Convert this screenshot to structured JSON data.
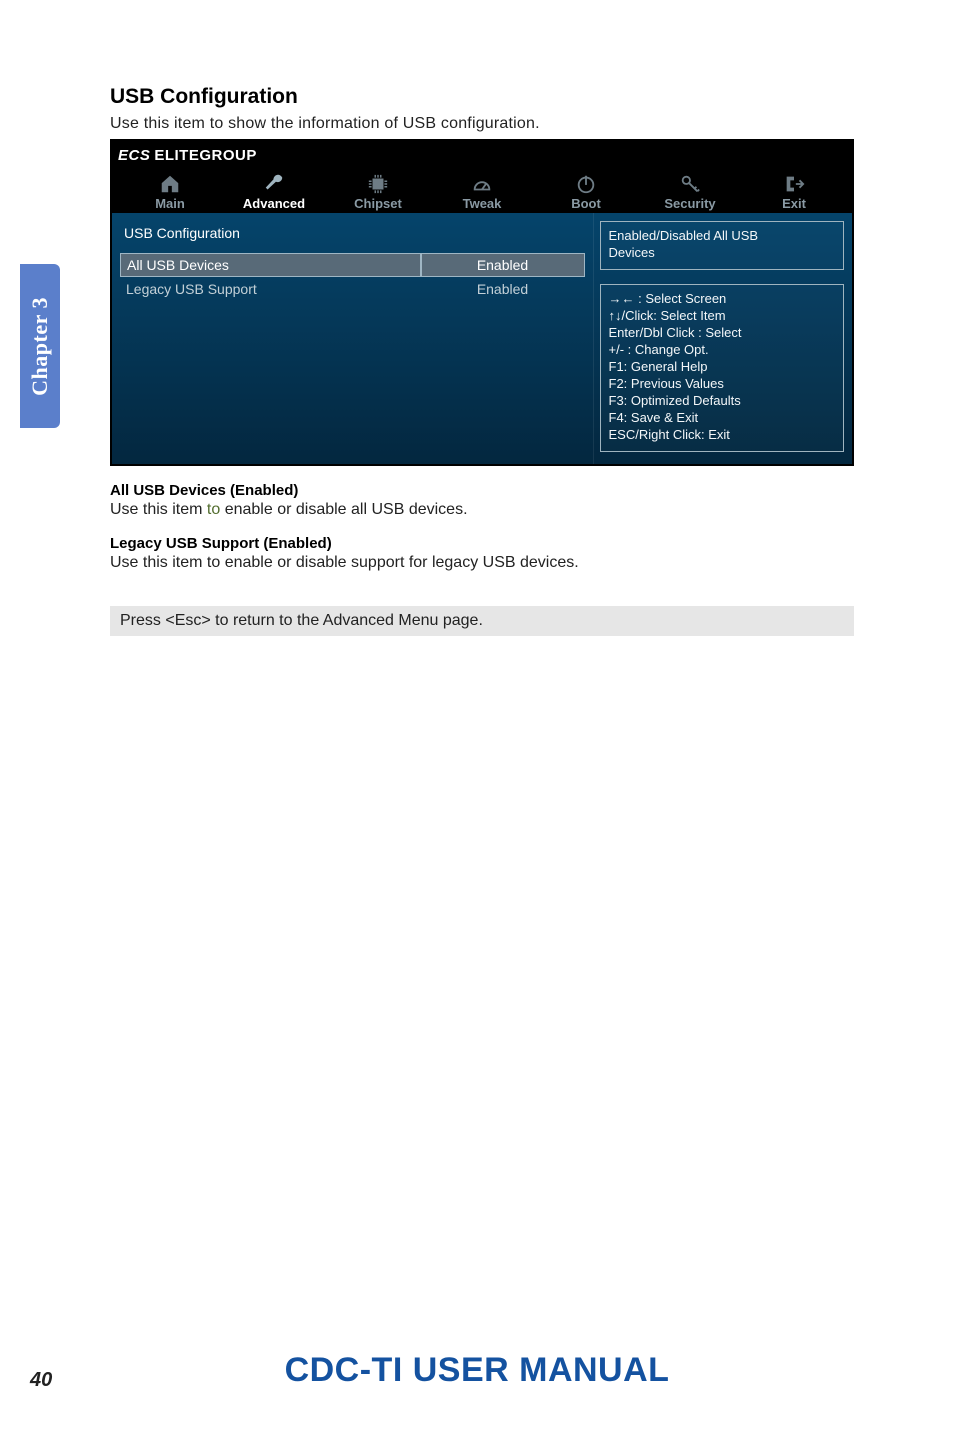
{
  "section": {
    "title": "USB Configuration",
    "desc": "Use this item to show the information of USB configuration."
  },
  "chapter_tab": "Chapter 3",
  "bios": {
    "brand_prefix": "ECS",
    "brand_name": "ELITEGROUP",
    "tabs": [
      {
        "name": "main",
        "label": "Main",
        "icon": "home-icon",
        "active": false
      },
      {
        "name": "advanced",
        "label": "Advanced",
        "icon": "wrench-icon",
        "active": true
      },
      {
        "name": "chipset",
        "label": "Chipset",
        "icon": "chip-icon",
        "active": false
      },
      {
        "name": "tweak",
        "label": "Tweak",
        "icon": "gauge-icon",
        "active": false
      },
      {
        "name": "boot",
        "label": "Boot",
        "icon": "power-icon",
        "active": false
      },
      {
        "name": "security",
        "label": "Security",
        "icon": "key-icon",
        "active": false
      },
      {
        "name": "exit",
        "label": "Exit",
        "icon": "exit-icon",
        "active": false
      }
    ],
    "heading": "USB Configuration",
    "rows": [
      {
        "label": "All USB Devices",
        "value": "Enabled",
        "selected": true
      },
      {
        "label": "Legacy USB Support",
        "value": "Enabled",
        "selected": false
      }
    ],
    "info_box": {
      "line1": "Enabled/Disabled All USB",
      "line2": "Devices"
    },
    "nav_box": {
      "l1": "→←   : Select Screen",
      "l2": "↑↓/Click: Select Item",
      "l3": "Enter/Dbl Click : Select",
      "l4": "+/- : Change Opt.",
      "l5": "F1: General Help",
      "l6": "F2: Previous Values",
      "l7": "F3: Optimized Defaults",
      "l8": "F4: Save & Exit",
      "l9": "ESC/Right Click: Exit"
    }
  },
  "items": [
    {
      "heading": "All USB Devices (Enabled)",
      "desc_pre": "Use this item ",
      "desc_to": "to",
      "desc_post": " enable or disable all USB devices."
    },
    {
      "heading": "Legacy USB Support (Enabled)",
      "desc_pre": "Use this item to enable or disable support for legacy USB devices.",
      "desc_to": "",
      "desc_post": ""
    }
  ],
  "note": "Press <Esc> to return to the Advanced Menu page.",
  "footer_title": "CDC-TI USER MANUAL",
  "page_number": "40"
}
